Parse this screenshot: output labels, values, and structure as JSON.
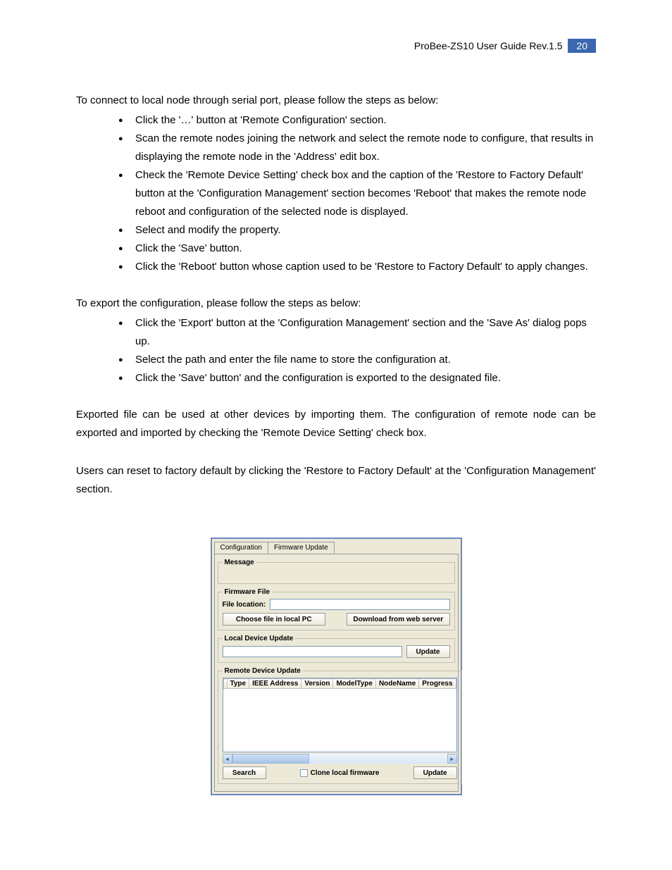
{
  "header": {
    "title": "ProBee-ZS10 User Guide Rev.1.5",
    "page": "20"
  },
  "p1": "To connect to local node through serial port, please follow the steps as below:",
  "list1": [
    "Click the '…' button at 'Remote Configuration' section.",
    "Scan the remote nodes joining the network and select the remote node to configure, that results in displaying the remote node in the 'Address' edit box.",
    "Check the 'Remote Device Setting' check box and the caption of the 'Restore to Factory Default' button at the 'Configuration Management' section becomes 'Reboot' that makes the remote node reboot and configuration of the selected node is displayed.",
    "Select and modify the property.",
    "Click the 'Save' button.",
    "Click the 'Reboot' button whose caption used to be 'Restore to Factory Default' to apply changes."
  ],
  "p2": "To export the configuration, please follow the steps as below:",
  "list2": [
    "Click the 'Export' button at the 'Configuration Management' section and the 'Save As' dialog pops up.",
    "Select the path and enter the file name to store the configuration at.",
    "Click the 'Save' button' and the configuration is exported to the designated file."
  ],
  "p3": "Exported file can be used at other devices by importing them. The configuration of remote node can be exported and imported by checking the 'Remote Device Setting' check box.",
  "p4": "Users can reset to factory default by clicking the 'Restore to Factory Default' at the 'Configuration Management' section.",
  "dialog": {
    "tabs": {
      "configuration": "Configuration",
      "firmware": "Firmware Update"
    },
    "groups": {
      "message": "Message",
      "firmware_file": "Firmware File",
      "file_location": "File location:",
      "choose_file": "Choose file in local PC",
      "download": "Download from web server",
      "local_device_update": "Local Device Update",
      "update": "Update",
      "remote_device_update": "Remote Device Update",
      "cols": {
        "c0": "",
        "type": "Type",
        "ieee": "IEEE Address",
        "version": "Version",
        "model": "ModelType",
        "node": "NodeName",
        "progress": "Progress"
      },
      "search": "Search",
      "clone": "Clone local firmware",
      "update2": "Update"
    }
  }
}
